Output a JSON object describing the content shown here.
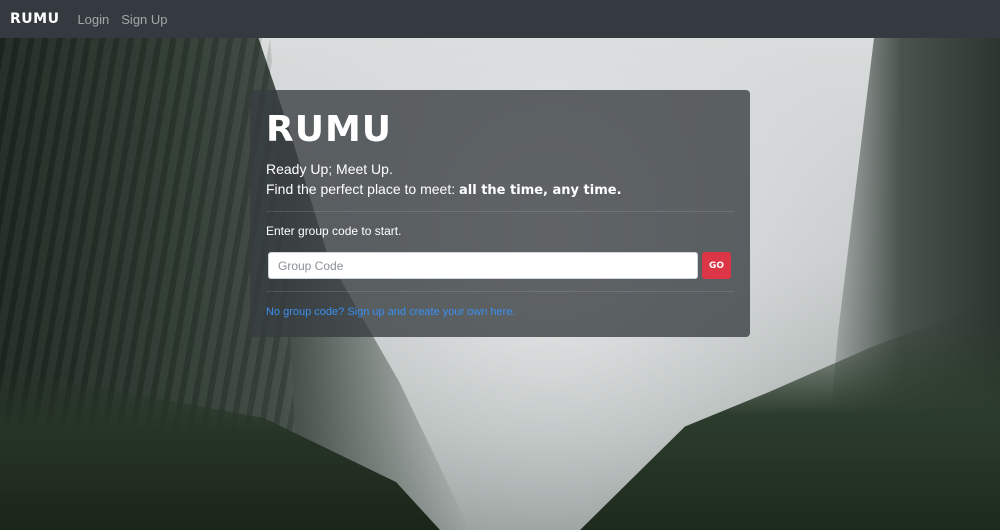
{
  "navbar": {
    "brand": "RUMU",
    "links": [
      {
        "label": "Login"
      },
      {
        "label": "Sign Up"
      }
    ]
  },
  "hero": {
    "logo": "RUMU",
    "tagline": "Ready Up; Meet Up.",
    "find_text": "Find the perfect place to meet: ",
    "find_emphasis": "all the time, any time.",
    "enter_label": "Enter group code to start.",
    "group_code": {
      "value": "",
      "placeholder": "Group Code"
    },
    "go_button": "GO",
    "signup_link": "No group code? Sign up and create your own here."
  },
  "colors": {
    "navbar": "#343a40",
    "go_button": "#dc3545",
    "link": "#3b8ff0"
  }
}
